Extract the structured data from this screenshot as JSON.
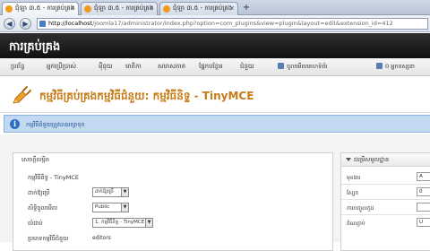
{
  "browser": {
    "tabs": [
      {
        "title": "ជុំឡា ៣.៥ - ការគ្រប់គ្រង",
        "active": true
      },
      {
        "title": "ជុំឡា ៣.៥ - ការគ្រប់គ្រង",
        "active": false
      },
      {
        "title": "ជុំឡា ៣.៥ - ការគ្រប់គ្រង",
        "active": false
      }
    ],
    "new_tab": "+",
    "url_host": "http://localhost",
    "url_path": "/joomla17/administrator/index.php?option=com_plugins&view=plugin&layout=edit&extension_id=412"
  },
  "header": {
    "title": "ការគ្រប់គ្រង"
  },
  "menu": {
    "items": [
      "ប្រព័ន្ធ",
      "អ្នកប្រើប្រាស់",
      "ម៉ឺនុយ",
      "មាតិកា",
      "សមាសភាគ",
      "ផ្នែកបន្ថែម",
      "ជំនួយ"
    ],
    "right_1": "ចូលមើលគេហទំព័រ",
    "right_2": "0 អ្នកទស្សនា"
  },
  "page": {
    "title": "កម្មវិធីគ្រប់គ្រងកម្មវិធីជំនួយ: កម្មវិធីនិទ្ទ - TinyMCE"
  },
  "message": {
    "text": "កម្មវិធីជំនួយត្រូវបានរក្សាទុក"
  },
  "form": {
    "legend": "សេចក្ដីលម្អិត",
    "fields": [
      {
        "label": "កម្មវិធីនិទ្ទ - TinyMCE",
        "value": ""
      },
      {
        "label": "ដាក់ឱ្យប្រើ",
        "value": "ដាក់ឱ្យប្រើ"
      },
      {
        "label": "សិទ្ធិចូលមើល",
        "value": "Public"
      },
      {
        "label": "លំដាប់",
        "value": "1. កម្មវិធីនិទ្ទ - TinyMCE"
      },
      {
        "label": "ប្រភេទកម្មវិធីជំនួយ",
        "value": "editors"
      }
    ]
  },
  "side": {
    "title": "ជម្រើសមូលដ្ឋាន",
    "rows": [
      {
        "label": "មុខងារ",
        "value": "A"
      },
      {
        "label": "ស្បែក",
        "value": "0"
      },
      {
        "label": "ការបញ្ចូលកូដ",
        "value": ""
      },
      {
        "label": "តំណភ្ជាប់",
        "value": "U"
      }
    ]
  },
  "colors": {
    "header_bg": "#1a1a1a",
    "title_orange": "#c77b15",
    "message_bg": "#c3d9f2"
  }
}
